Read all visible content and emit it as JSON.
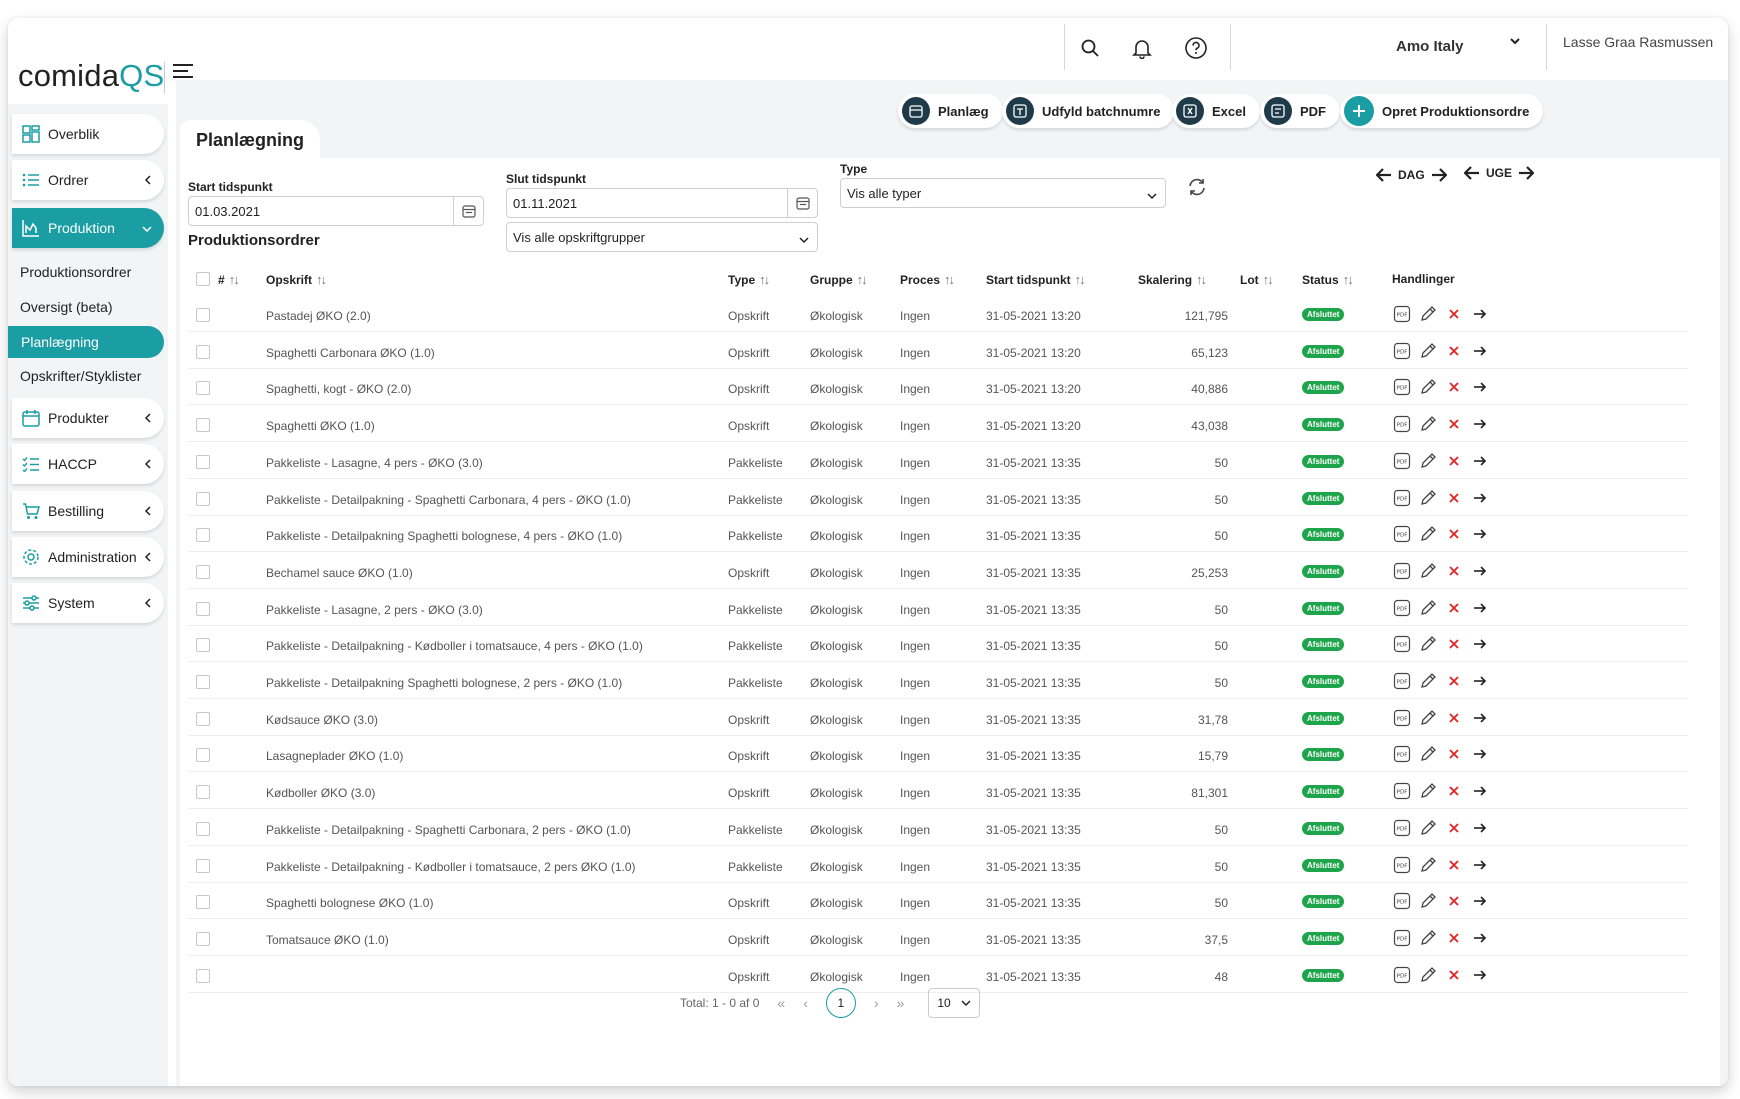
{
  "brand": {
    "name_main": "comida",
    "name_accent": "QS",
    "accent_color": "#1a9da3"
  },
  "header": {
    "company": "Amo Italy",
    "user": "Lasse Graa Rasmussen"
  },
  "sidebar": {
    "items": [
      {
        "label": "Overblik",
        "icon": "dashboard-icon"
      },
      {
        "label": "Ordrer",
        "icon": "list-icon"
      },
      {
        "label": "Produktion",
        "icon": "production-chart-icon"
      },
      {
        "label": "Produkter",
        "icon": "calendar-icon"
      },
      {
        "label": "HACCP",
        "icon": "checklist-icon"
      },
      {
        "label": "Bestilling",
        "icon": "cart-icon"
      },
      {
        "label": "Administration",
        "icon": "gear-icon"
      },
      {
        "label": "System",
        "icon": "sliders-icon"
      }
    ],
    "subitems": [
      "Produktionsordrer",
      "Oversigt (beta)",
      "Planlægning",
      "Opskrifter/Styklister"
    ]
  },
  "page": {
    "title": "Planlægning"
  },
  "actions": {
    "plan": "Planlæg",
    "batch": "Udfyld batchnumre",
    "excel": "Excel",
    "pdf": "PDF",
    "create": "Opret Produktionsordre"
  },
  "filters": {
    "start_label": "Start tidspunkt",
    "start_value": "01.03.2021",
    "end_label": "Slut tidspunkt",
    "end_value": "01.11.2021",
    "type_label": "Type",
    "type_value": "Vis alle typer",
    "group_value": "Vis alle opskriftgrupper",
    "day_label": "DAG",
    "week_label": "UGE"
  },
  "table": {
    "title": "Produktionsordrer",
    "headers": {
      "num": "#",
      "recipe": "Opskrift",
      "type": "Type",
      "group": "Gruppe",
      "process": "Proces",
      "start": "Start tidspunkt",
      "scale": "Skalering",
      "lot": "Lot",
      "status": "Status",
      "actions": "Handlinger"
    },
    "rows": [
      {
        "recipe": "Pastadej ØKO (2.0)",
        "type": "Opskrift",
        "group": "Økologisk",
        "process": "Ingen",
        "start": "31-05-2021 13:20",
        "scale": "121,795",
        "status": "Afsluttet"
      },
      {
        "recipe": "Spaghetti Carbonara ØKO (1.0)",
        "type": "Opskrift",
        "group": "Økologisk",
        "process": "Ingen",
        "start": "31-05-2021 13:20",
        "scale": "65,123",
        "status": "Afsluttet"
      },
      {
        "recipe": "Spaghetti, kogt - ØKO (2.0)",
        "type": "Opskrift",
        "group": "Økologisk",
        "process": "Ingen",
        "start": "31-05-2021 13:20",
        "scale": "40,886",
        "status": "Afsluttet"
      },
      {
        "recipe": "Spaghetti ØKO (1.0)",
        "type": "Opskrift",
        "group": "Økologisk",
        "process": "Ingen",
        "start": "31-05-2021 13:20",
        "scale": "43,038",
        "status": "Afsluttet"
      },
      {
        "recipe": "Pakkeliste - Lasagne, 4 pers - ØKO (3.0)",
        "type": "Pakkeliste",
        "group": "Økologisk",
        "process": "Ingen",
        "start": "31-05-2021 13:35",
        "scale": "50",
        "status": "Afsluttet"
      },
      {
        "recipe": "Pakkeliste - Detailpakning - Spaghetti Carbonara, 4 pers - ØKO (1.0)",
        "type": "Pakkeliste",
        "group": "Økologisk",
        "process": "Ingen",
        "start": "31-05-2021 13:35",
        "scale": "50",
        "status": "Afsluttet"
      },
      {
        "recipe": "Pakkeliste - Detailpakning Spaghetti bolognese, 4 pers - ØKO (1.0)",
        "type": "Pakkeliste",
        "group": "Økologisk",
        "process": "Ingen",
        "start": "31-05-2021 13:35",
        "scale": "50",
        "status": "Afsluttet"
      },
      {
        "recipe": "Bechamel sauce ØKO (1.0)",
        "type": "Opskrift",
        "group": "Økologisk",
        "process": "Ingen",
        "start": "31-05-2021 13:35",
        "scale": "25,253",
        "status": "Afsluttet"
      },
      {
        "recipe": "Pakkeliste - Lasagne, 2 pers - ØKO (3.0)",
        "type": "Pakkeliste",
        "group": "Økologisk",
        "process": "Ingen",
        "start": "31-05-2021 13:35",
        "scale": "50",
        "status": "Afsluttet"
      },
      {
        "recipe": "Pakkeliste - Detailpakning - Kødboller i tomatsauce, 4 pers - ØKO (1.0)",
        "type": "Pakkeliste",
        "group": "Økologisk",
        "process": "Ingen",
        "start": "31-05-2021 13:35",
        "scale": "50",
        "status": "Afsluttet"
      },
      {
        "recipe": "Pakkeliste - Detailpakning Spaghetti bolognese, 2 pers - ØKO (1.0)",
        "type": "Pakkeliste",
        "group": "Økologisk",
        "process": "Ingen",
        "start": "31-05-2021 13:35",
        "scale": "50",
        "status": "Afsluttet"
      },
      {
        "recipe": "Kødsauce ØKO (3.0)",
        "type": "Opskrift",
        "group": "Økologisk",
        "process": "Ingen",
        "start": "31-05-2021 13:35",
        "scale": "31,78",
        "status": "Afsluttet"
      },
      {
        "recipe": "Lasagneplader ØKO (1.0)",
        "type": "Opskrift",
        "group": "Økologisk",
        "process": "Ingen",
        "start": "31-05-2021 13:35",
        "scale": "15,79",
        "status": "Afsluttet"
      },
      {
        "recipe": "Kødboller ØKO (3.0)",
        "type": "Opskrift",
        "group": "Økologisk",
        "process": "Ingen",
        "start": "31-05-2021 13:35",
        "scale": "81,301",
        "status": "Afsluttet"
      },
      {
        "recipe": "Pakkeliste - Detailpakning - Spaghetti Carbonara, 2 pers - ØKO (1.0)",
        "type": "Pakkeliste",
        "group": "Økologisk",
        "process": "Ingen",
        "start": "31-05-2021 13:35",
        "scale": "50",
        "status": "Afsluttet"
      },
      {
        "recipe": "Pakkeliste - Detailpakning - Kødboller i tomatsauce, 2 pers ØKO (1.0)",
        "type": "Pakkeliste",
        "group": "Økologisk",
        "process": "Ingen",
        "start": "31-05-2021 13:35",
        "scale": "50",
        "status": "Afsluttet"
      },
      {
        "recipe": "Spaghetti bolognese ØKO (1.0)",
        "type": "Opskrift",
        "group": "Økologisk",
        "process": "Ingen",
        "start": "31-05-2021 13:35",
        "scale": "50",
        "status": "Afsluttet"
      },
      {
        "recipe": "Tomatsauce ØKO (1.0)",
        "type": "Opskrift",
        "group": "Økologisk",
        "process": "Ingen",
        "start": "31-05-2021 13:35",
        "scale": "37,5",
        "status": "Afsluttet"
      },
      {
        "recipe": "",
        "type": "Opskrift",
        "group": "Økologisk",
        "process": "Ingen",
        "start": "31-05-2021 13:35",
        "scale": "48",
        "status": "Afsluttet"
      }
    ]
  },
  "pagination": {
    "total": "Total: 1 - 0 af 0",
    "current_page": "1",
    "page_size": "10"
  },
  "colors": {
    "accent": "#1a9da3",
    "status_done": "#1ea44a",
    "delete": "#e02424",
    "dark_button": "#1f3b4a"
  }
}
